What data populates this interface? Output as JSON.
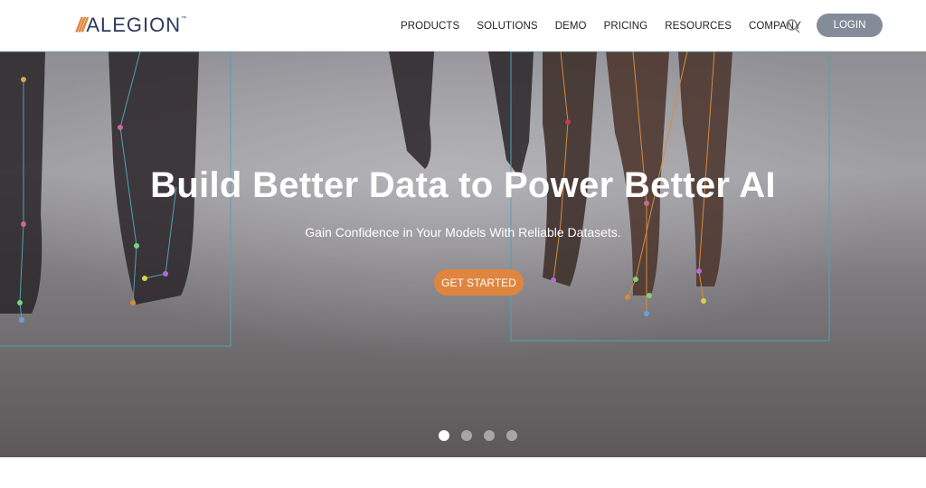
{
  "logo": {
    "text": "ALEGION",
    "tm": "™"
  },
  "nav": {
    "items": [
      {
        "label": "PRODUCTS"
      },
      {
        "label": "SOLUTIONS"
      },
      {
        "label": "DEMO"
      },
      {
        "label": "PRICING"
      },
      {
        "label": "RESOURCES"
      },
      {
        "label": "COMPANY"
      }
    ],
    "search_icon": "search-icon",
    "login_label": "LOGIN"
  },
  "hero": {
    "title": "Build Better Data to Power Better AI",
    "subtitle": "Gain Confidence in Your Models With Reliable Datasets.",
    "cta_label": "GET STARTED",
    "slides": 4,
    "active_slide": 1
  },
  "colors": {
    "accent": "#e0853f",
    "brand_navy": "#2d3a5e",
    "login_bg": "#858c99",
    "annotation": "#4fa3b5"
  }
}
